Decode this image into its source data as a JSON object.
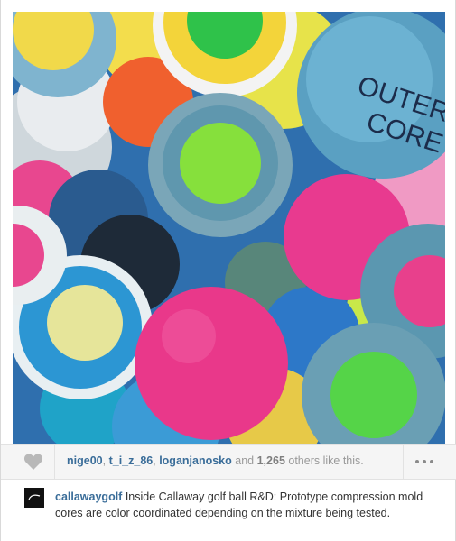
{
  "post": {
    "photo_alt": "Prototype golf ball compression cores",
    "photo_text": [
      "OUTER",
      "CORE"
    ]
  },
  "likes": {
    "users": [
      "nige00",
      "t_i_z_86",
      "loganjanosko"
    ],
    "separator": ",",
    "conjunction": "and",
    "count": "1,265",
    "suffix": "others like this."
  },
  "caption": {
    "author": "callawaygolf",
    "text": "Inside Callaway golf ball R&D: Prototype compression mold cores are color coordinated depending on the mixture being tested."
  },
  "icons": {
    "like": "heart-icon",
    "more": "more-options-icon",
    "avatar": "callaway-logo"
  },
  "colors": {
    "link": "#3a6d99",
    "muted": "#9a9a9a"
  }
}
